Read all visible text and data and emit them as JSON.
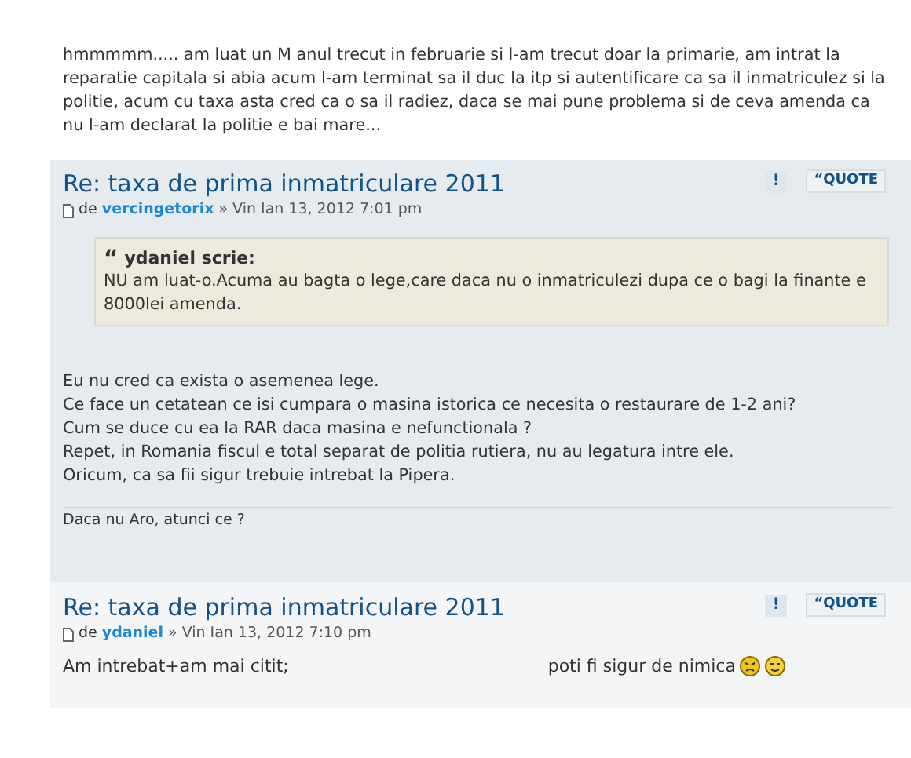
{
  "posts": [
    {
      "body_lines": [
        "hmmmmm..... am luat un M anul trecut in februarie si l-am trecut doar la primarie, am intrat la reparatie capitala si abia acum l-am terminat sa il duc la itp si autentificare ca sa il inmatriculez si la politie, acum cu taxa asta cred ca o sa il radiez, daca se mai pune problema si de ceva amenda ca nu l-am declarat la politie e bai mare..."
      ]
    },
    {
      "title": "Re: taxa de prima inmatriculare 2011",
      "report": "!",
      "quote_button": "“QUOTE",
      "by": "de",
      "author": "vercingetorix",
      "separator": "»",
      "date": "Vin Ian 13, 2012 7:01 pm",
      "quote": {
        "mark": "“",
        "author_line": "ydaniel scrie:",
        "text": "NU am luat-o.Acuma au bagta o lege,care daca nu o inmatriculezi dupa ce o bagi la finante e 8000lei amenda."
      },
      "body_lines": [
        "Eu nu cred ca exista o asemenea lege.",
        "Ce face un cetatean ce isi cumpara o masina istorica ce necesita o restaurare de 1-2 ani?",
        "Cum se duce cu ea la RAR daca masina e nefunctionala ?",
        "Repet, in Romania fiscul e total separat de politia rutiera, nu au legatura intre ele.",
        "Oricum, ca sa fii sigur trebuie intrebat la Pipera."
      ],
      "signature": "Daca nu Aro, atunci ce ?"
    },
    {
      "title": "Re: taxa de prima inmatriculare 2011",
      "report": "!",
      "quote_button": "“QUOTE",
      "by": "de",
      "author": "ydaniel",
      "separator": "»",
      "date": "Vin Ian 13, 2012 7:10 pm",
      "body_parts": [
        "Am intrebat+am mai citit;",
        "poti fi sigur de nimica"
      ]
    }
  ]
}
